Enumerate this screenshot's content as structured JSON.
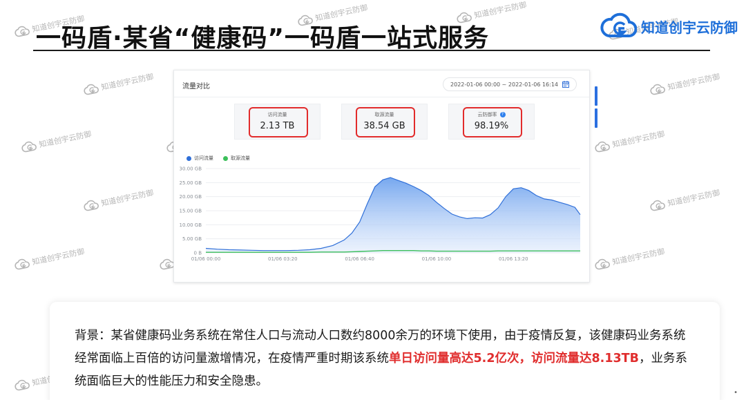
{
  "slide": {
    "title": "一码盾·某省“健康码”一码盾一站式服务"
  },
  "brand": {
    "name": "知道创宇云防御",
    "accent_color": "#1e6fd9",
    "logo_icon": "cloud-g-logo-icon"
  },
  "watermark_text": "知道创宇云防御",
  "dashboard": {
    "title": "流量对比",
    "date_range": "2022-01-06 00:00 ~ 2022-01-06 16:14",
    "calendar_icon": "calendar-icon",
    "stats": [
      {
        "label": "访问流量",
        "value": "2.13 TB"
      },
      {
        "label": "取源流量",
        "value": "38.54 GB"
      },
      {
        "label": "云防御率",
        "value": "98.19%"
      }
    ],
    "highlight_color": "#e22b2b"
  },
  "chart_data": {
    "type": "area",
    "legend": [
      "访问流量",
      "取源流量"
    ],
    "series_colors": [
      "#2f6fd8",
      "#3cbf5a"
    ],
    "y_ticks": [
      "30.00 GB",
      "25.00 GB",
      "20.00 GB",
      "15.00 GB",
      "10.00 GB",
      "5.00 GB",
      "0 B"
    ],
    "ylim": [
      0,
      30
    ],
    "yunit": "GB",
    "x_ticks": [
      "01/06 00:00",
      "01/06 03:20",
      "01/06 06:40",
      "01/06 10:00",
      "01/06 13:20"
    ],
    "x_hours": [
      0,
      0.5,
      1,
      1.5,
      2,
      2.5,
      3,
      3.5,
      4,
      4.5,
      5,
      5.5,
      6,
      6.33,
      6.67,
      7,
      7.33,
      7.67,
      8,
      8.33,
      8.67,
      9,
      9.33,
      9.67,
      10,
      10.33,
      10.67,
      11,
      11.33,
      11.67,
      12,
      12.33,
      12.67,
      13,
      13.33,
      13.67,
      14,
      14.33,
      14.67,
      15,
      15.33,
      15.67,
      16,
      16.23
    ],
    "series": [
      {
        "name": "访问流量",
        "values": [
          1.6,
          1.3,
          1.1,
          1.0,
          0.9,
          0.8,
          0.8,
          0.8,
          0.9,
          1.1,
          1.6,
          2.6,
          4.6,
          7.0,
          11.0,
          17.5,
          23.5,
          26.0,
          26.8,
          25.8,
          24.8,
          23.6,
          22.2,
          20.4,
          18.0,
          15.8,
          13.8,
          12.8,
          12.2,
          12.5,
          12.4,
          13.6,
          16.0,
          20.0,
          22.8,
          23.2,
          22.2,
          20.4,
          19.2,
          18.8,
          18.0,
          17.2,
          16.2,
          13.6
        ]
      },
      {
        "name": "取源流量",
        "values": [
          0.2,
          0.2,
          0.2,
          0.2,
          0.2,
          0.2,
          0.2,
          0.2,
          0.2,
          0.2,
          0.3,
          0.3,
          0.3,
          0.4,
          0.5,
          0.6,
          0.7,
          0.8,
          0.8,
          0.8,
          0.8,
          0.8,
          0.7,
          0.7,
          0.6,
          0.6,
          0.6,
          0.6,
          0.6,
          0.6,
          0.6,
          0.6,
          0.7,
          0.7,
          0.7,
          0.7,
          0.7,
          0.7,
          0.7,
          0.7,
          0.7,
          0.7,
          0.7,
          0.7
        ]
      }
    ]
  },
  "background_card": {
    "para_a": "背景：某省健康码业务系统在常住人口与流动人口数约8000余万的环境下使用，由于疫情反复，该健康码业务系统经常面临上百倍的访问量激增情况，在疫情严重时期该系统",
    "highlight": "单日访问量高达5.2亿次，访问流量达8.13TB",
    "para_b": "，业务系统面临巨大的性能压力和安全隐患。",
    "highlight_color": "#e02d2d"
  },
  "page_marker": "•"
}
